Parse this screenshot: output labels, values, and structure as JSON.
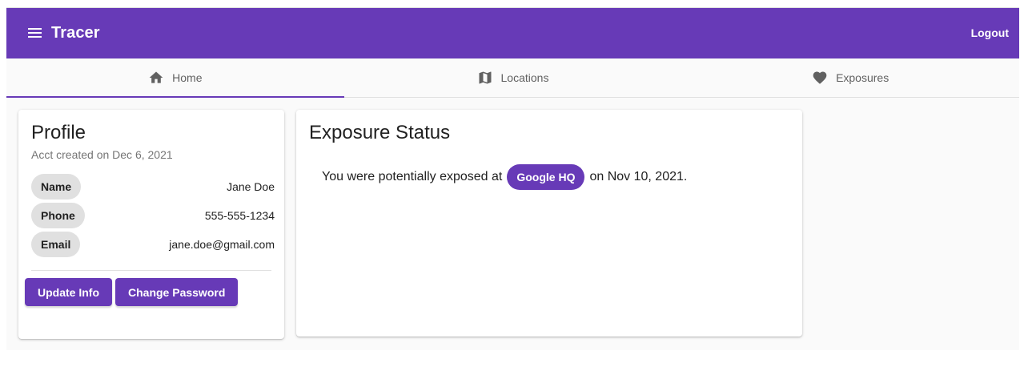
{
  "appbar": {
    "title": "Tracer",
    "logout_label": "Logout",
    "color": "#673ab7"
  },
  "tabs": [
    {
      "label": "Home",
      "icon": "home-icon",
      "active": true
    },
    {
      "label": "Locations",
      "icon": "map-icon",
      "active": false
    },
    {
      "label": "Exposures",
      "icon": "heart-icon",
      "active": false
    }
  ],
  "profile": {
    "title": "Profile",
    "created": "Acct created on Dec 6, 2021",
    "fields": [
      {
        "label": "Name",
        "value": "Jane Doe"
      },
      {
        "label": "Phone",
        "value": "555-555-1234"
      },
      {
        "label": "Email",
        "value": "jane.doe@gmail.com"
      }
    ],
    "update_label": "Update Info",
    "change_password_label": "Change Password"
  },
  "exposure": {
    "title": "Exposure Status",
    "text_before": "You were potentially exposed at",
    "location": "Google HQ",
    "text_after": "on Nov 10, 2021."
  }
}
